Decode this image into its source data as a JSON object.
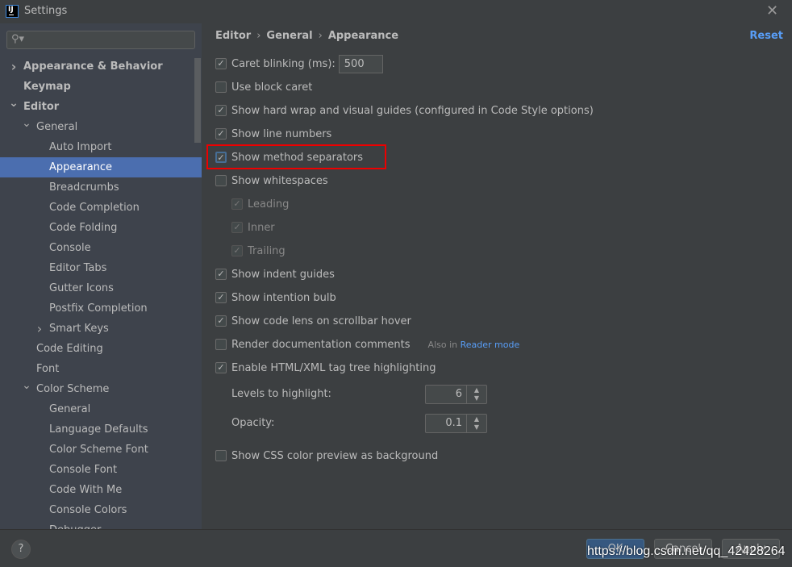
{
  "window": {
    "title": "Settings",
    "app_icon": "IJ"
  },
  "search": {
    "placeholder": ""
  },
  "sidebar": {
    "items": [
      {
        "label": "Appearance & Behavior",
        "level": 0,
        "bold": true,
        "expander": "right"
      },
      {
        "label": "Keymap",
        "level": 0,
        "bold": true
      },
      {
        "label": "Editor",
        "level": 0,
        "bold": true,
        "expander": "down"
      },
      {
        "label": "General",
        "level": 1,
        "expander": "down"
      },
      {
        "label": "Auto Import",
        "level": 2
      },
      {
        "label": "Appearance",
        "level": 2,
        "selected": true
      },
      {
        "label": "Breadcrumbs",
        "level": 2
      },
      {
        "label": "Code Completion",
        "level": 2
      },
      {
        "label": "Code Folding",
        "level": 2
      },
      {
        "label": "Console",
        "level": 2
      },
      {
        "label": "Editor Tabs",
        "level": 2
      },
      {
        "label": "Gutter Icons",
        "level": 2
      },
      {
        "label": "Postfix Completion",
        "level": 2
      },
      {
        "label": "Smart Keys",
        "level": 2,
        "expander": "right"
      },
      {
        "label": "Code Editing",
        "level": 1
      },
      {
        "label": "Font",
        "level": 1
      },
      {
        "label": "Color Scheme",
        "level": 1,
        "expander": "down"
      },
      {
        "label": "General",
        "level": 2
      },
      {
        "label": "Language Defaults",
        "level": 2
      },
      {
        "label": "Color Scheme Font",
        "level": 2
      },
      {
        "label": "Console Font",
        "level": 2
      },
      {
        "label": "Code With Me",
        "level": 2
      },
      {
        "label": "Console Colors",
        "level": 2
      },
      {
        "label": "Debugger",
        "level": 2
      }
    ]
  },
  "breadcrumb": [
    "Editor",
    "General",
    "Appearance"
  ],
  "reset_label": "Reset",
  "options": [
    {
      "label": "Caret blinking (ms):",
      "checked": true,
      "input_value": "500"
    },
    {
      "label": "Use block caret",
      "checked": false
    },
    {
      "label": "Show hard wrap and visual guides (configured in Code Style options)",
      "checked": true
    },
    {
      "label": "Show line numbers",
      "checked": true
    },
    {
      "label": "Show method separators",
      "checked": true,
      "focused": true,
      "highlighted": true
    },
    {
      "label": "Show whitespaces",
      "checked": false
    },
    {
      "label": "Leading",
      "checked": true,
      "disabled": true,
      "indent": true
    },
    {
      "label": "Inner",
      "checked": true,
      "disabled": true,
      "indent": true
    },
    {
      "label": "Trailing",
      "checked": true,
      "disabled": true,
      "indent": true
    },
    {
      "label": "Show indent guides",
      "checked": true
    },
    {
      "label": "Show intention bulb",
      "checked": true
    },
    {
      "label": "Show code lens on scrollbar hover",
      "checked": true
    },
    {
      "label": "Render documentation comments",
      "checked": false,
      "also_prefix": "Also in",
      "also_link": "Reader mode"
    },
    {
      "label": "Enable HTML/XML tag tree highlighting",
      "checked": true
    }
  ],
  "levels": {
    "label": "Levels to highlight:",
    "value": "6"
  },
  "opacity": {
    "label": "Opacity:",
    "value": "0.1"
  },
  "css_preview": {
    "label": "Show CSS color preview as background",
    "checked": false
  },
  "footer": {
    "help": "?",
    "ok": "OK",
    "cancel": "Cancel",
    "apply": "Apply",
    "watermark": "https://blog.csdn.net/qq_42428264"
  },
  "colors": {
    "accent": "#4b6eaf",
    "link": "#589df6",
    "highlight_box": "#ee0000"
  }
}
